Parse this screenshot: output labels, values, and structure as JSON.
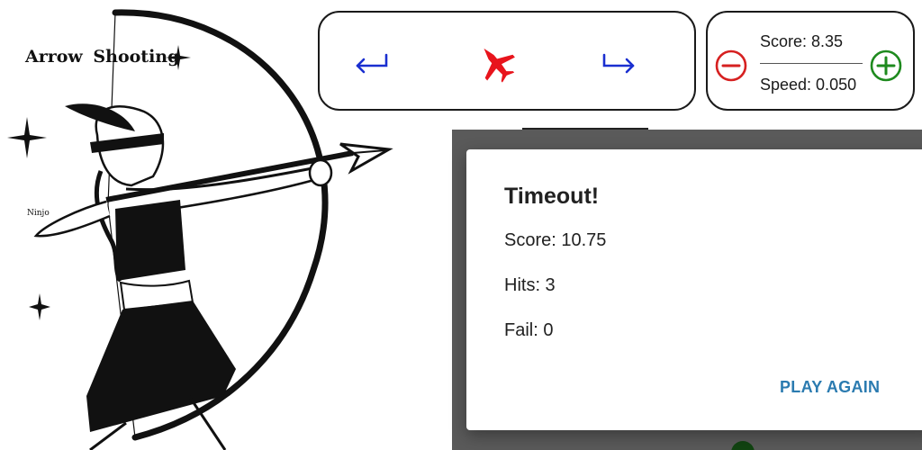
{
  "illustration": {
    "title": "Arrow  Shooting",
    "signature": "Ninjo"
  },
  "controls": {
    "left_icon": "return-left-arrow-icon",
    "center_icon": "fighter-jet-icon",
    "right_icon": "return-right-arrow-icon",
    "arrow_color": "#1a2fd0",
    "jet_color": "#e8141c"
  },
  "score_panel": {
    "score_text": "Score: 8.35",
    "speed_text": "Speed: 0.050",
    "minus_icon": "minus-circle-icon",
    "plus_icon": "plus-circle-icon",
    "minus_color": "#d62020",
    "plus_color": "#1e8a1e"
  },
  "dialog": {
    "title": "Timeout!",
    "score_text": "Score: 10.75",
    "hits_text": "Hits: 3",
    "fail_text": "Fail: 0",
    "button_label": "PLAY AGAIN",
    "button_color": "#2b7bb0"
  }
}
